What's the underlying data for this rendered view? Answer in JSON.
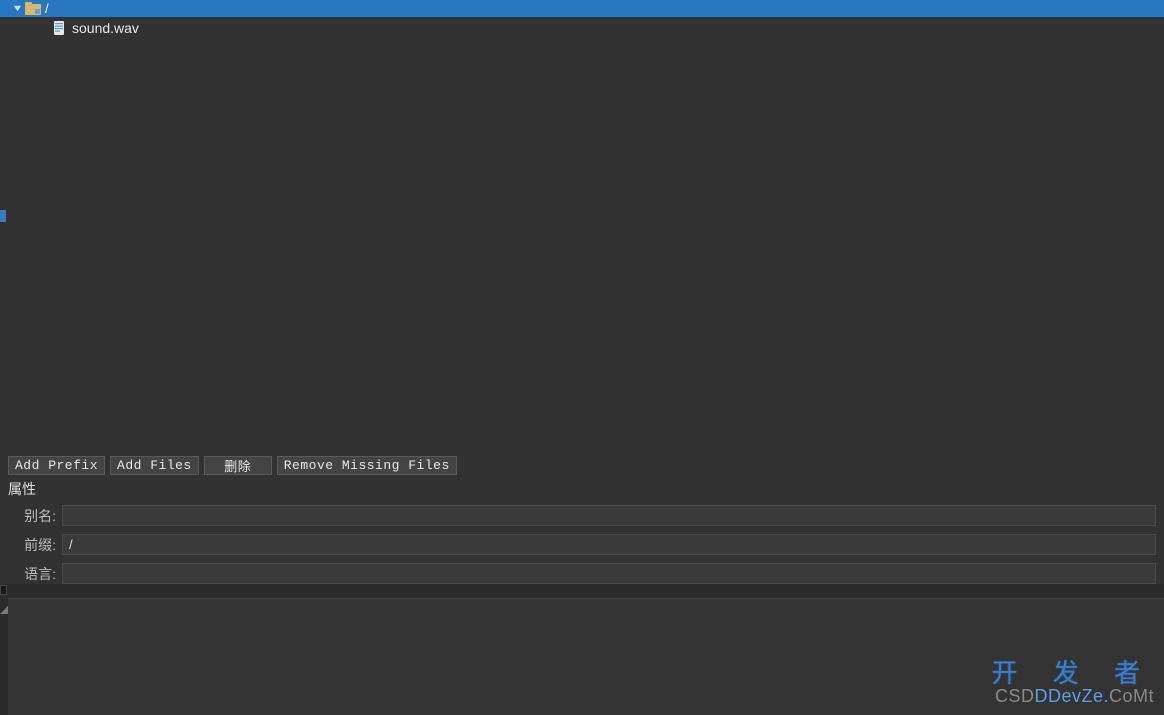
{
  "tree": {
    "root_label": "/",
    "child_label": "sound.wav"
  },
  "buttons": {
    "add_prefix": "Add Prefix",
    "add_files": "Add Files",
    "delete": "删除",
    "remove_missing": "Remove Missing Files"
  },
  "properties": {
    "section_title": "属性",
    "alias_label": "别名:",
    "alias_value": "",
    "prefix_label": "前缀:",
    "prefix_value": "/",
    "language_label": "语言:",
    "language_value": ""
  },
  "watermark": {
    "line1": "开 发 者",
    "line2_pre": "CSD",
    "line2_mid": "DDevZe.",
    "line2_suf": "CoMt"
  }
}
